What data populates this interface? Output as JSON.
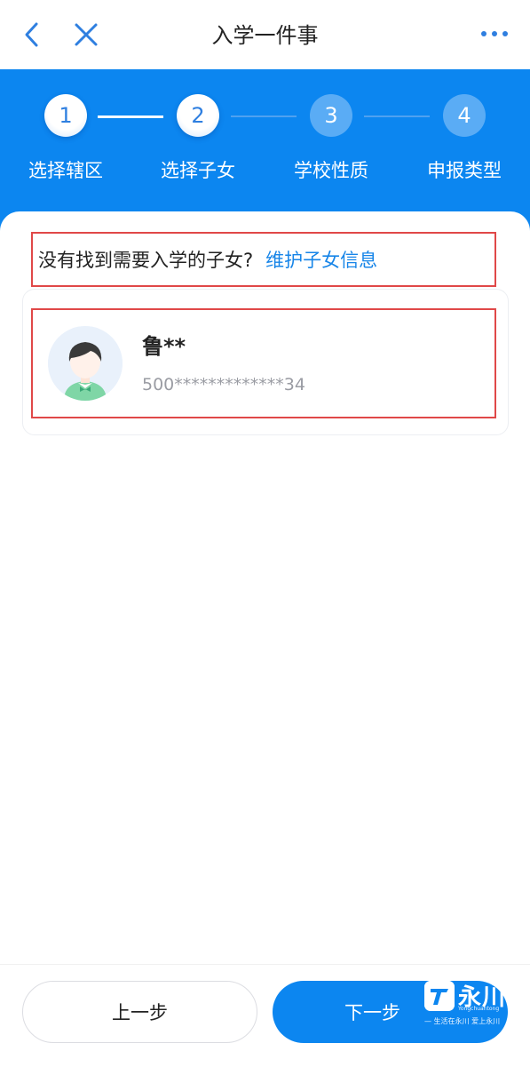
{
  "nav": {
    "title": "入学一件事",
    "back_icon": "chevron-left-icon",
    "close_icon": "close-icon",
    "more_icon": "more-icon"
  },
  "steps": [
    {
      "number": "1",
      "label": "选择辖区",
      "state": "done"
    },
    {
      "number": "2",
      "label": "选择子女",
      "state": "done"
    },
    {
      "number": "3",
      "label": "学校性质",
      "state": "todo"
    },
    {
      "number": "4",
      "label": "申报类型",
      "state": "todo"
    }
  ],
  "hint": {
    "text": "没有找到需要入学的子女?",
    "link": "维护子女信息"
  },
  "child": {
    "name": "鲁**",
    "id_number": "500*************34",
    "avatar_icon": "child-avatar-icon"
  },
  "footer": {
    "prev_label": "上一步",
    "next_label": "下一步"
  },
  "watermark": {
    "title": "永川",
    "subtitle": "Yongchuantong",
    "slogan": "— 生活在永川  爱上永川"
  },
  "colors": {
    "primary": "#0c86f0",
    "highlight_border": "#e04848",
    "link": "#1785e8"
  }
}
